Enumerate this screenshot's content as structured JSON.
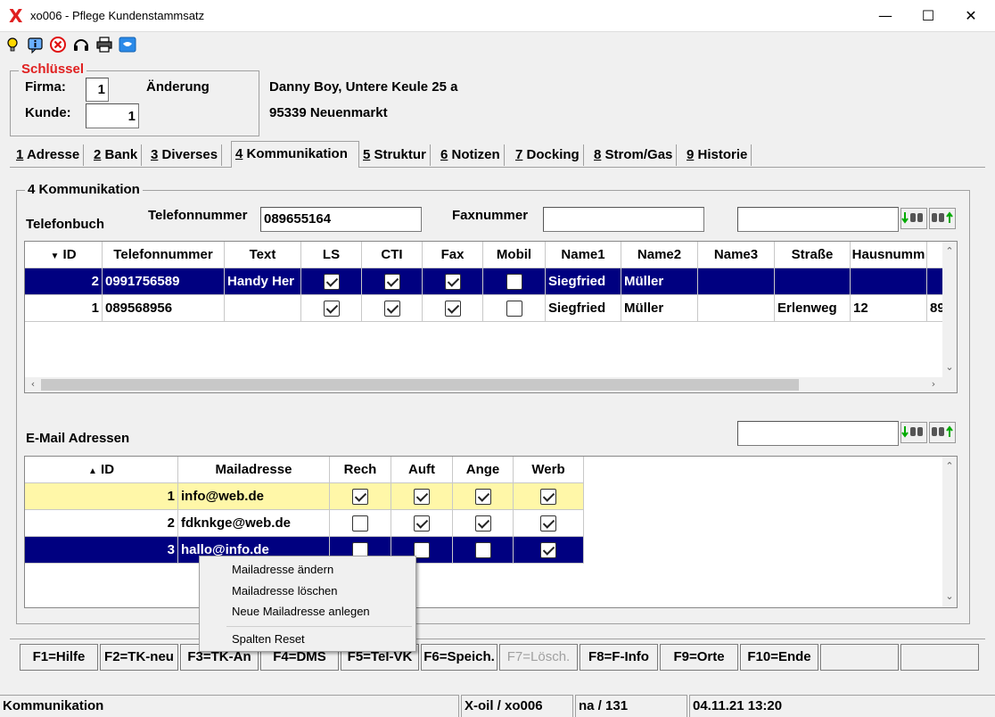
{
  "window": {
    "title": "xo006 - Pflege Kundenstammsatz",
    "logo": "X",
    "minimize": "—",
    "maximize": "☐",
    "close": "✕"
  },
  "toolbar_icons": [
    "lightbulb-icon",
    "info-icon",
    "cancel-icon",
    "headset-icon",
    "printer-icon",
    "message-icon"
  ],
  "key_group": {
    "legend": "Schlüssel",
    "firma_label": "Firma:",
    "firma_value": "1",
    "mode": "Änderung",
    "kunde_label": "Kunde:",
    "kunde_value": "1"
  },
  "customer": {
    "line1": "Danny Boy, Untere Keule 25 a",
    "line2": "95339 Neuenmarkt"
  },
  "tabs": [
    {
      "num": "1",
      "label": "Adresse"
    },
    {
      "num": "2",
      "label": "Bank"
    },
    {
      "num": "3",
      "label": "Diverses"
    },
    {
      "num": "4",
      "label": "Kommunikation"
    },
    {
      "num": "5",
      "label": "Struktur"
    },
    {
      "num": "6",
      "label": "Notizen"
    },
    {
      "num": "7",
      "label": "Docking"
    },
    {
      "num": "8",
      "label": "Strom/Gas"
    },
    {
      "num": "9",
      "label": "Historie"
    }
  ],
  "panel": {
    "legend": "4 Kommunikation",
    "phonebook_label": "Telefonbuch",
    "telefon_label": "Telefonnummer",
    "telefon_value": "089655164",
    "fax_label": "Faxnummer",
    "fax_value": "",
    "phone_search_value": "",
    "email_section_label": "E-Mail Adressen",
    "email_search_value": ""
  },
  "search_buttons": {
    "find_next": "↓🔍",
    "find_prev": "🔍↑"
  },
  "phone_grid": {
    "sort_arrow": "▼",
    "columns": [
      "ID",
      "Telefonnummer",
      "Text",
      "LS",
      "CTI",
      "Fax",
      "Mobil",
      "Name1",
      "Name2",
      "Name3",
      "Straße",
      "Hausnumm"
    ],
    "rows": [
      {
        "id": "2",
        "telefon": "0991756589",
        "text": "Handy Her",
        "ls": true,
        "cti": true,
        "fax": true,
        "mobil": false,
        "name1": "Siegfried",
        "name2": "Müller",
        "name3": "",
        "strasse": "",
        "hausnr": "",
        "extra": "",
        "selected": true
      },
      {
        "id": "1",
        "telefon": "089568956",
        "text": "",
        "ls": true,
        "cti": true,
        "fax": true,
        "mobil": false,
        "name1": "Siegfried",
        "name2": "Müller",
        "name3": "",
        "strasse": "Erlenweg",
        "hausnr": "12",
        "extra": "89",
        "selected": false
      }
    ]
  },
  "email_grid": {
    "sort_arrow": "▲",
    "columns": [
      "ID",
      "Mailadresse",
      "Rech",
      "Auft",
      "Ange",
      "Werb"
    ],
    "rows": [
      {
        "id": "1",
        "mail": "info@web.de",
        "rech": true,
        "auft": true,
        "ange": true,
        "werb": true,
        "state": "highlight"
      },
      {
        "id": "2",
        "mail": "fdknkge@web.de",
        "rech": false,
        "auft": true,
        "ange": true,
        "werb": true,
        "state": "normal"
      },
      {
        "id": "3",
        "mail": "hallo@info.de",
        "rech": false,
        "auft": false,
        "ange": false,
        "werb": true,
        "state": "selected"
      }
    ]
  },
  "context_menu": {
    "items": [
      "Mailadresse ändern",
      "Mailadresse löschen",
      "Neue Mailadresse anlegen",
      "Spalten Reset"
    ]
  },
  "fkeys": [
    {
      "label": "F1=Hilfe",
      "enabled": true
    },
    {
      "label": "F2=TK-neu",
      "enabled": true
    },
    {
      "label": "F3=TK-Än",
      "enabled": true
    },
    {
      "label": "F4=DMS",
      "enabled": true
    },
    {
      "label": "F5=Tel-VK",
      "enabled": true
    },
    {
      "label": "F6=Speich.",
      "enabled": true
    },
    {
      "label": "F7=Lösch.",
      "enabled": false
    },
    {
      "label": "F8=F-Info",
      "enabled": true
    },
    {
      "label": "F9=Orte",
      "enabled": true
    },
    {
      "label": "F10=Ende",
      "enabled": true
    },
    {
      "label": "",
      "enabled": true
    },
    {
      "label": "",
      "enabled": true
    }
  ],
  "statusbar": {
    "section": "Kommunikation",
    "system": "X-oil / xo006",
    "user": "na / 131",
    "datetime": "04.11.21 13:20"
  }
}
